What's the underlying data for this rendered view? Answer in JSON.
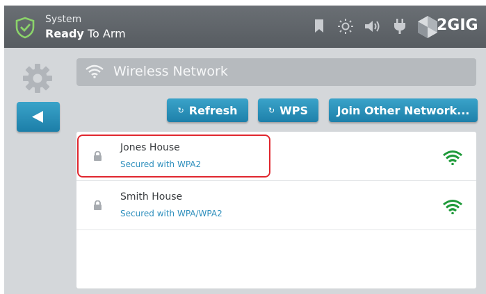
{
  "status": {
    "line1": "System",
    "line2_bold": "Ready",
    "line2_rest": " To Arm"
  },
  "topbar_icons": [
    "bookmark-icon",
    "brightness-icon",
    "volume-icon",
    "power-plug-icon"
  ],
  "brand": "2GIG",
  "page_title": "Wireless Network",
  "buttons": {
    "refresh": "Refresh",
    "wps": "WPS",
    "join_other": "Join Other Network..."
  },
  "networks": [
    {
      "name": "Jones House",
      "security": "Secured with WPA2"
    },
    {
      "name": "Smith House",
      "security": "Secured with WPA/WPA2"
    }
  ],
  "colors": {
    "topbar": "#5e6368",
    "accent_blue": "#2a91bd",
    "signal_green": "#1f9a3a",
    "highlight_red": "#e0262e"
  }
}
